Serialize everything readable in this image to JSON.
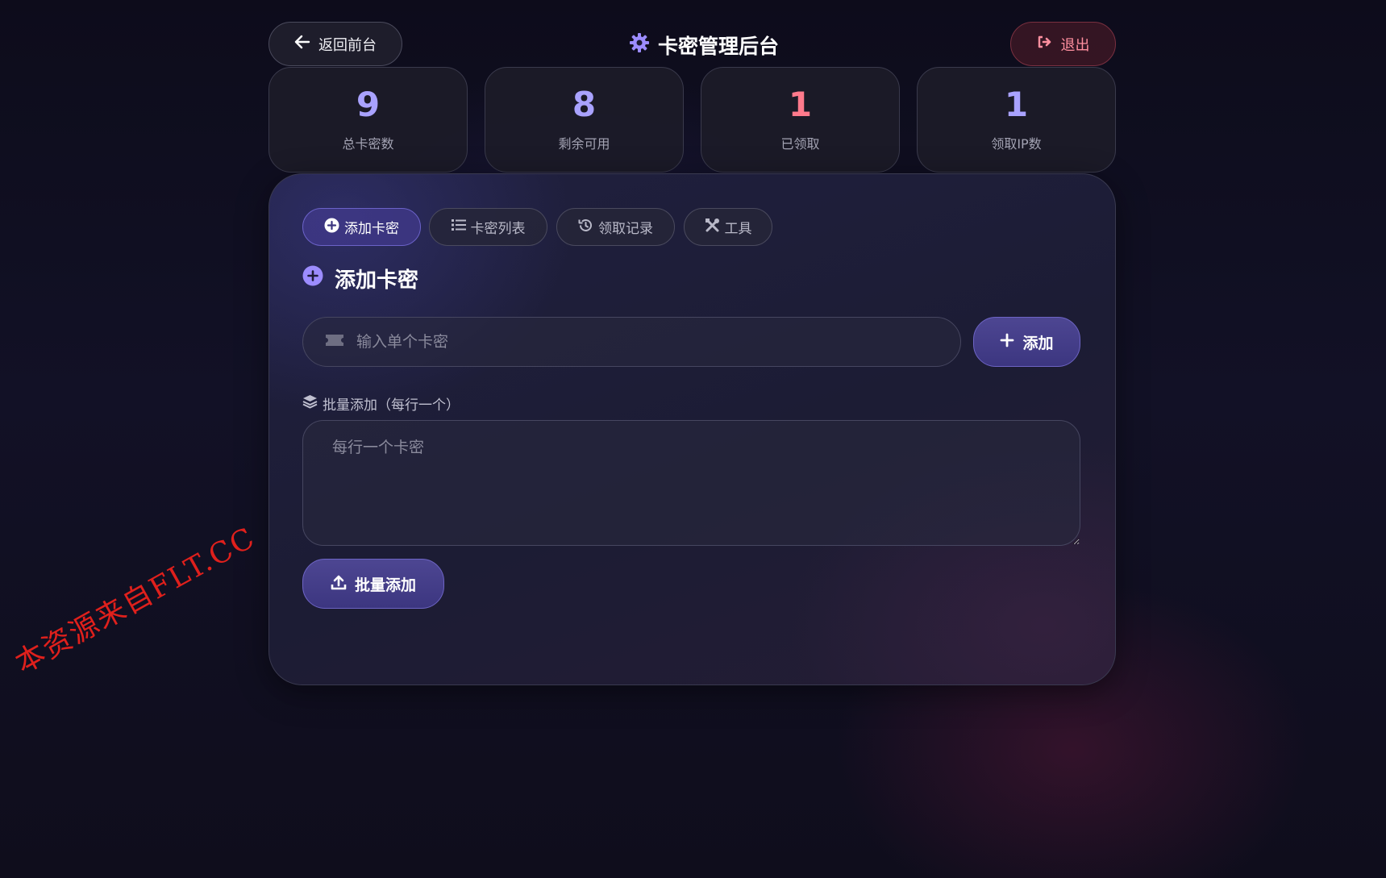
{
  "header": {
    "back_label": "返回前台",
    "title": "卡密管理后台",
    "logout_label": "退出"
  },
  "stats": [
    {
      "value": "9",
      "label": "总卡密数",
      "color": "#a9a2ff"
    },
    {
      "value": "8",
      "label": "剩余可用",
      "color": "#a9a2ff"
    },
    {
      "value": "1",
      "label": "已领取",
      "color": "#ff7a8c"
    },
    {
      "value": "1",
      "label": "领取IP数",
      "color": "#a9a2ff"
    }
  ],
  "tabs": [
    {
      "label": "添加卡密",
      "icon": "plus-circle-icon",
      "active": true
    },
    {
      "label": "卡密列表",
      "icon": "list-icon",
      "active": false
    },
    {
      "label": "领取记录",
      "icon": "history-icon",
      "active": false
    },
    {
      "label": "工具",
      "icon": "tools-icon",
      "active": false
    }
  ],
  "section": {
    "title": "添加卡密",
    "single_placeholder": "输入单个卡密",
    "single_value": "",
    "add_label": "添加",
    "batch_label": "批量添加（每行一个）",
    "batch_placeholder": "每行一个卡密",
    "batch_value": "",
    "batch_button_label": "批量添加"
  },
  "watermark": "本资源来自FLT.CC",
  "colors": {
    "accent": "#a9a2ff",
    "danger": "#ff7a8c",
    "button": "#4d4692"
  }
}
